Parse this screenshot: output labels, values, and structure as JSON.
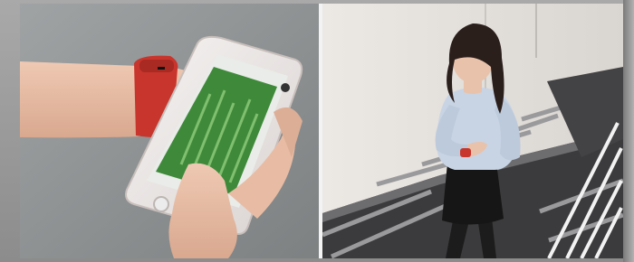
{
  "photos": [
    {
      "subject": "hand-holding-smartphone-with-fitness-tracker",
      "tracker_color": "#c8352c",
      "screen_color": "#3f8a3a"
    },
    {
      "subject": "woman-on-stairs-checking-fitness-tracker",
      "tracker_color": "#c8352c"
    }
  ]
}
